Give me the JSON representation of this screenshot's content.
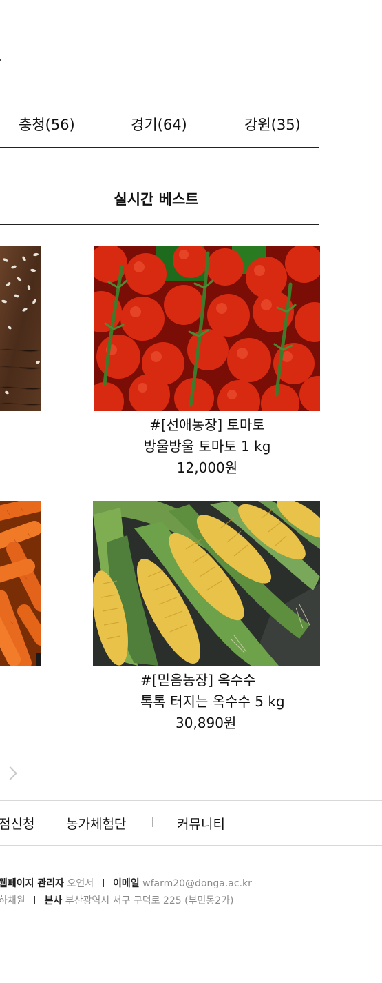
{
  "regions": [
    {
      "label": "충청(56)"
    },
    {
      "label": "경기(64)"
    },
    {
      "label": "강원(35)"
    }
  ],
  "best_label": "실시간 베스트",
  "products": [
    {
      "title": "#[선애농장] 토마토",
      "subtitle": "방울방울 토마토 1 kg",
      "price": "12,000원"
    },
    {
      "title": "#[믿음농장] 옥수수",
      "subtitle": "톡톡 터지는 옥수수 5 kg",
      "price": "30,890원"
    }
  ],
  "nav": {
    "item1": "점신청",
    "item2": "농가체험단",
    "item3": "커뮤니티"
  },
  "footer": {
    "admin_label": "웹페이지 관리자",
    "admin_name": "오연서",
    "email_label": "이메일",
    "email": "wfarm20@donga.ac.kr",
    "name2": "하채원",
    "hq_label": "본사",
    "address": "부산광역시 서구 구덕로 225 (부민동2가)"
  }
}
